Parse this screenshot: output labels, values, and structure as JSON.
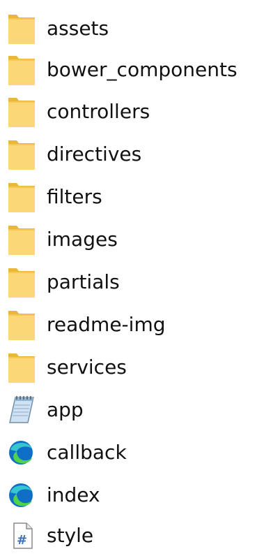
{
  "explorer": {
    "items": [
      {
        "label": "assets",
        "icon": "folder-icon"
      },
      {
        "label": "bower_components",
        "icon": "folder-icon"
      },
      {
        "label": "controllers",
        "icon": "folder-icon"
      },
      {
        "label": "directives",
        "icon": "folder-icon"
      },
      {
        "label": "filters",
        "icon": "folder-icon"
      },
      {
        "label": "images",
        "icon": "folder-icon"
      },
      {
        "label": "partials",
        "icon": "folder-icon"
      },
      {
        "label": "readme-img",
        "icon": "folder-icon"
      },
      {
        "label": "services",
        "icon": "folder-icon"
      },
      {
        "label": "app",
        "icon": "notepad-file-icon"
      },
      {
        "label": "callback",
        "icon": "edge-html-file-icon"
      },
      {
        "label": "index",
        "icon": "edge-html-file-icon"
      },
      {
        "label": "style",
        "icon": "css-file-icon"
      }
    ]
  },
  "colors": {
    "folder_back": "#e8b73c",
    "folder_front": "#fbd778",
    "edge_blue": "#0f6fc6",
    "edge_teal": "#37c6d0",
    "edge_green": "#4fd34a"
  }
}
